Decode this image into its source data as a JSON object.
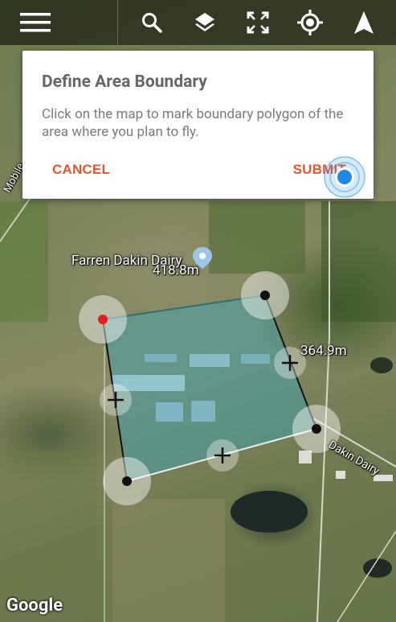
{
  "dialog": {
    "title": "Define Area Boundary",
    "body": "Click on the map to mark boundary polygon of the area where you plan to fly.",
    "cancel_label": "CANCEL",
    "submit_label": "SUBMIT"
  },
  "toolbar": {
    "icons": [
      "menu-icon",
      "search-icon",
      "layers-icon",
      "fullscreen-icon",
      "my-location-icon",
      "navigation-icon"
    ]
  },
  "map": {
    "place_label": "Farren Dakin Dairy",
    "distance_top": "418.8m",
    "distance_right": "364.9m",
    "road_label_right": "Dakin Dairy",
    "road_label_left": "Mobile",
    "attribution": "Google"
  },
  "colors": {
    "accent": "#e8552a",
    "polygon_fill": "#3aa6b8",
    "start_vertex": "#e02020",
    "location_blue": "#1e88e5"
  }
}
